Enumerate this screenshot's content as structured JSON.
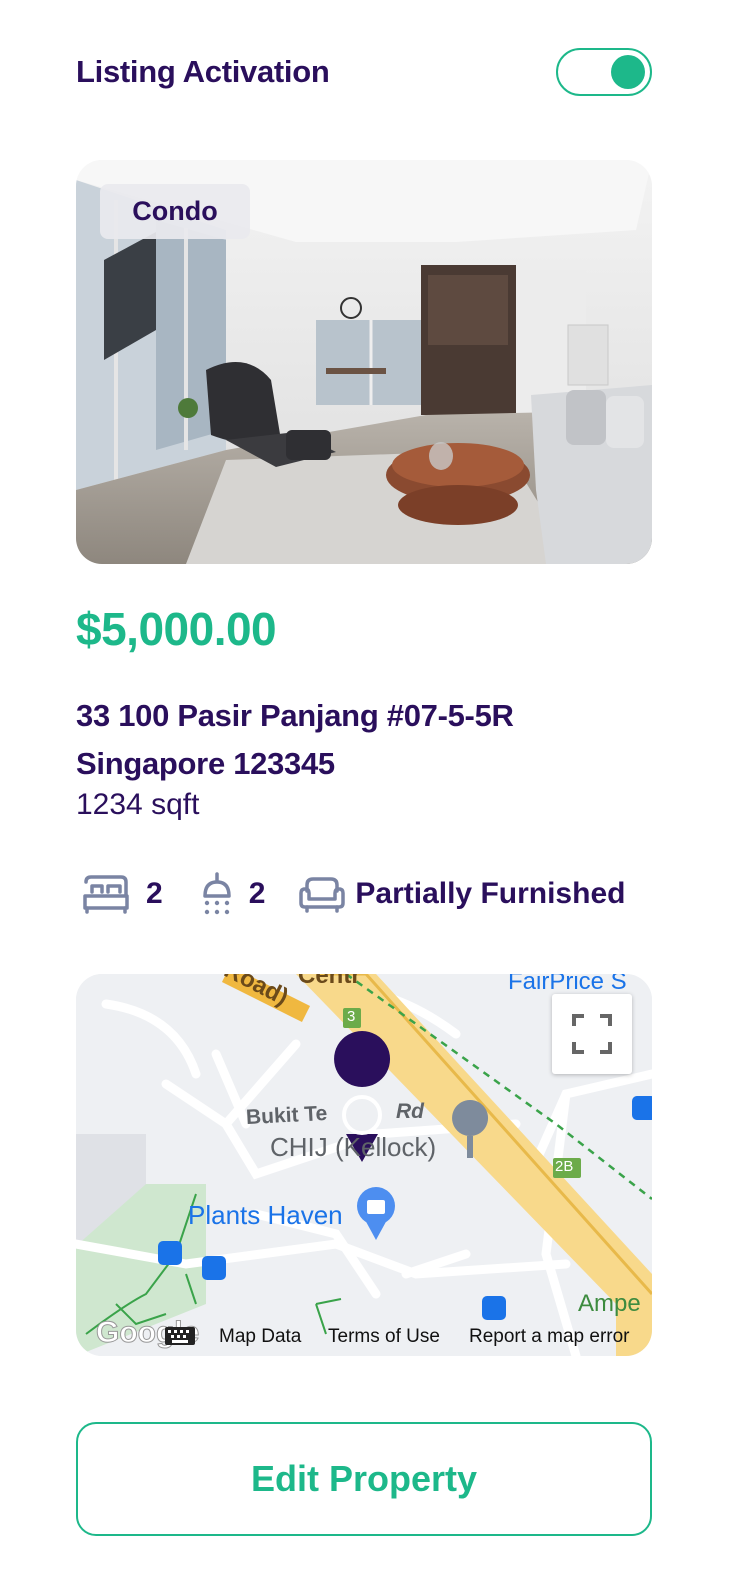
{
  "header": {
    "title": "Listing Activation",
    "toggle_on": true
  },
  "listing": {
    "type_badge": "Condo",
    "price": "$5,000.00",
    "address_line1": "33 100 Pasir Panjang #07-5-5R",
    "address_line2": "Singapore 123345",
    "area": "1234 sqft",
    "bedrooms": "2",
    "bathrooms": "2",
    "furnishing": "Partially Furnished"
  },
  "map": {
    "road_label": "Road)",
    "centre_label": "Centr",
    "poi_fairprice": "FairPrice S",
    "street_label": "Bukit Te",
    "street_label_end": "Rd",
    "poi_school": "CHIJ (Kellock)",
    "poi_shop": "Plants Haven",
    "poi_area": "Ampe",
    "road_badge_1": "3",
    "road_badge_2": "2B",
    "google_logo": "Google",
    "attribution": {
      "map_data": "Map Data",
      "terms": "Terms of Use",
      "report": "Report a map error"
    }
  },
  "actions": {
    "edit_label": "Edit Property"
  },
  "colors": {
    "brand_primary": "#2a0f5c",
    "accent": "#1db88a",
    "icon_muted": "#7a84a3"
  }
}
